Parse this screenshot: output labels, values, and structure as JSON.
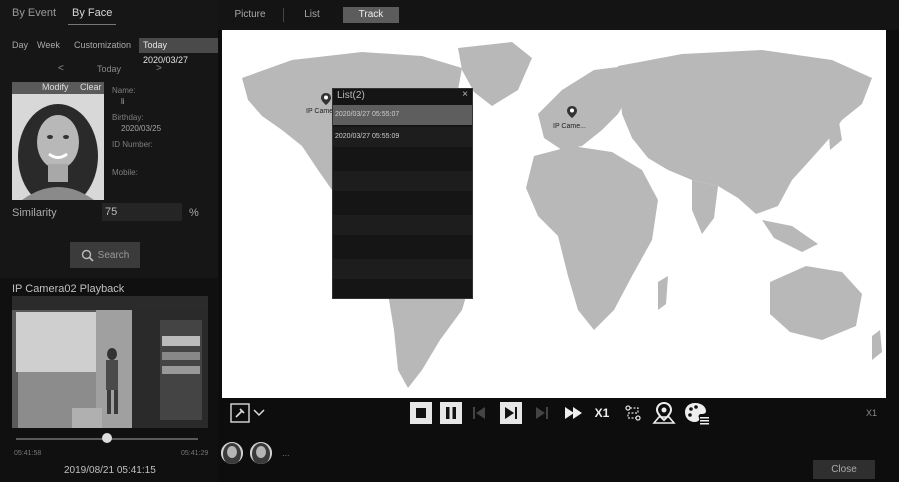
{
  "top_tabs": {
    "by_event": "By Event",
    "by_face": "By Face"
  },
  "date_tabs": {
    "day": "Day",
    "week": "Week",
    "customization": "Customization",
    "today": "Today 2020/03/27"
  },
  "date_nav": {
    "prev": "<",
    "label": "Today",
    "next": ">"
  },
  "photo_header": {
    "modify": "Modify",
    "clear": "Clear"
  },
  "person_info": {
    "name_label": "Name:",
    "name_value": "li",
    "birthday_label": "Birthday:",
    "birthday_value": "2020/03/25",
    "id_label": "ID Number:",
    "mobile_label": "Mobile:"
  },
  "similarity": {
    "label": "Similarity",
    "value": "75",
    "unit": "%"
  },
  "search_button": {
    "label": "Search"
  },
  "playback": {
    "title": "IP Camera02 Playback",
    "time_start": "05:41:58",
    "time_end": "05:41:29",
    "progress": 0.5,
    "datetime": "2019/08/21 05:41:15"
  },
  "view_tabs": [
    "Picture",
    "List",
    "Track"
  ],
  "map_pins": [
    {
      "label": "IP Camer"
    },
    {
      "label": "IP Came..."
    }
  ],
  "list_popup": {
    "title": "List(2)",
    "close": "×",
    "rows": [
      "2020/03/27 05:55:07",
      "2020/03/27 05:55:09"
    ]
  },
  "controls": {
    "speed_button": "X1",
    "speed_readout": "X1"
  },
  "faces_more": "...",
  "close_button": "Close",
  "colors": {
    "panel": "#161616",
    "active_tab": "#5c5c5c",
    "map_land": "#b8b8b8",
    "map_bg": "#ffffff"
  }
}
